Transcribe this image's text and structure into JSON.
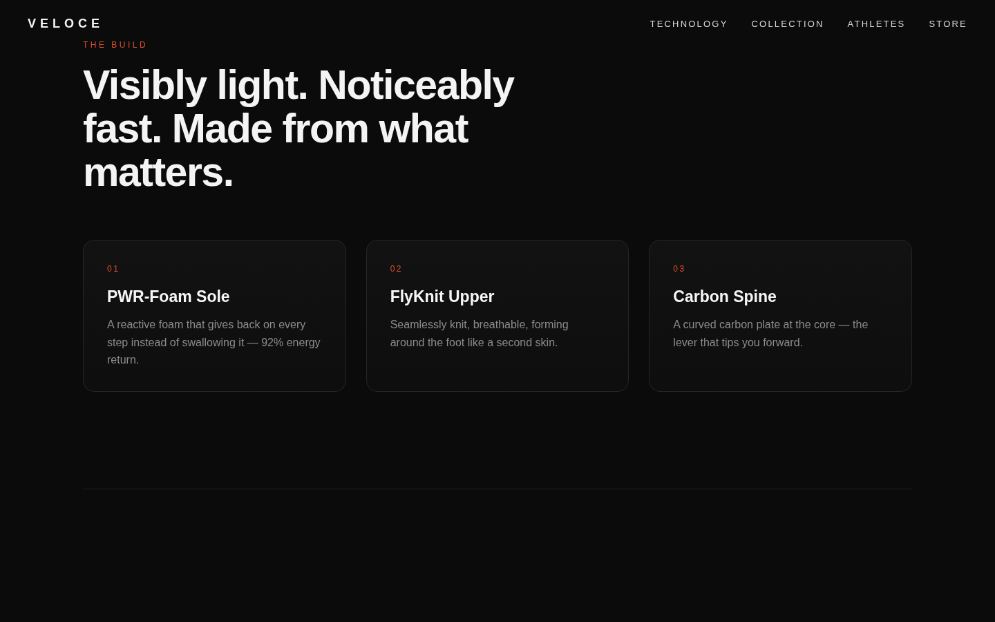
{
  "header": {
    "logo": "VELOCE",
    "nav": [
      {
        "label": "TECHNOLOGY"
      },
      {
        "label": "COLLECTION"
      },
      {
        "label": "ATHLETES"
      },
      {
        "label": "STORE"
      }
    ]
  },
  "section": {
    "eyebrow": "THE BUILD",
    "headline": "Visibly light. Noticeably fast. Made from what matters.",
    "cards": [
      {
        "number": "01",
        "title": "PWR-Foam Sole",
        "text": "A reactive foam that gives back on every step instead of swallowing it — 92% energy return."
      },
      {
        "number": "02",
        "title": "FlyKnit Upper",
        "text": "Seamlessly knit, breathable, forming around the foot like a second skin."
      },
      {
        "number": "03",
        "title": "Carbon Spine",
        "text": "A curved carbon plate at the core — the lever that tips you forward."
      }
    ]
  }
}
